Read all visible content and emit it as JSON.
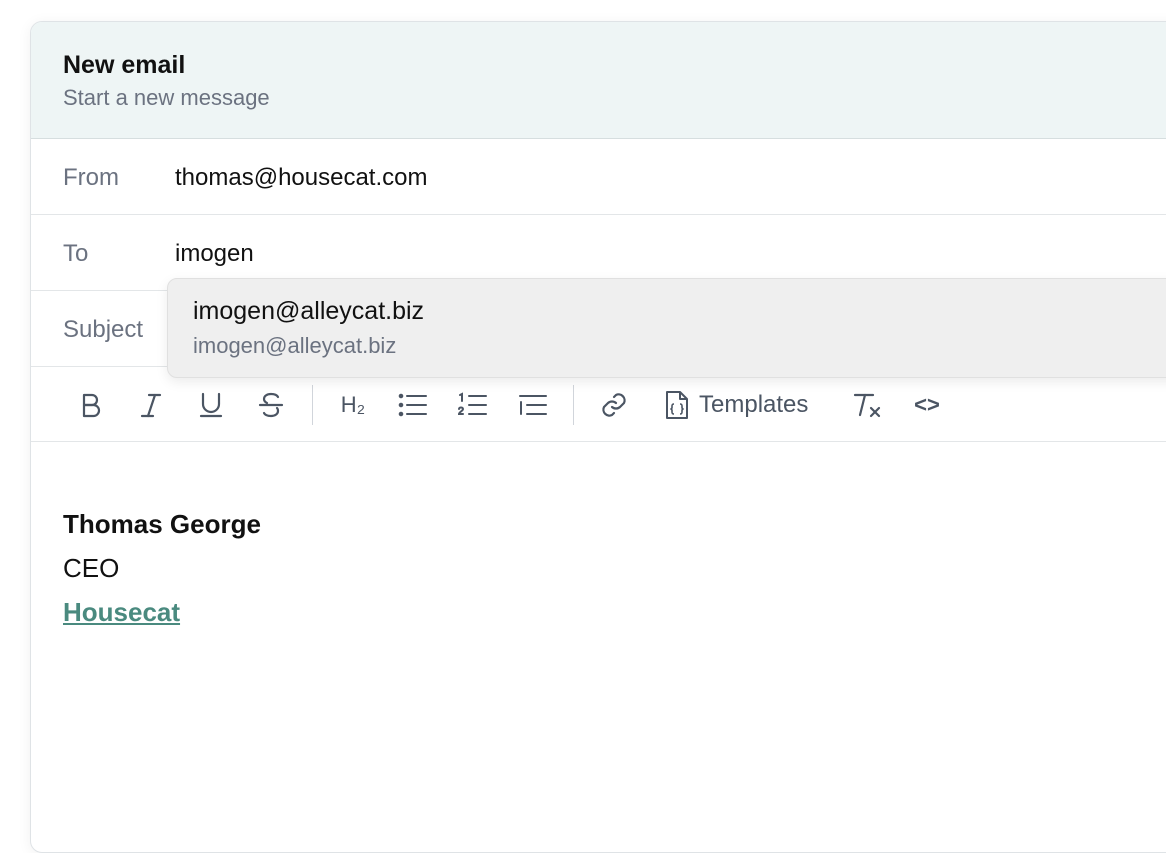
{
  "header": {
    "title": "New email",
    "subtitle": "Start a new message"
  },
  "fields": {
    "from_label": "From",
    "from_value": "thomas@housecat.com",
    "to_label": "To",
    "to_value": "imogen",
    "subject_label": "Subject",
    "subject_value": ""
  },
  "autocomplete": {
    "primary": "imogen@alleycat.biz",
    "secondary": "imogen@alleycat.biz"
  },
  "toolbar": {
    "icons": [
      "bold-icon",
      "italic-icon",
      "underline-icon",
      "strikethrough-icon",
      "heading-2-icon",
      "bullet-list-icon",
      "numbered-list-icon",
      "indent-icon",
      "link-icon",
      "templates-icon",
      "clear-format-icon",
      "code-icon"
    ],
    "templates_label": "Templates",
    "heading_label": "H₂",
    "code_label": "<>"
  },
  "signature": {
    "name": "Thomas George",
    "title": "CEO",
    "company": "Housecat"
  },
  "colors": {
    "header_bg": "#eef5f5",
    "link": "#4a8a7f",
    "muted": "#6b7280"
  }
}
